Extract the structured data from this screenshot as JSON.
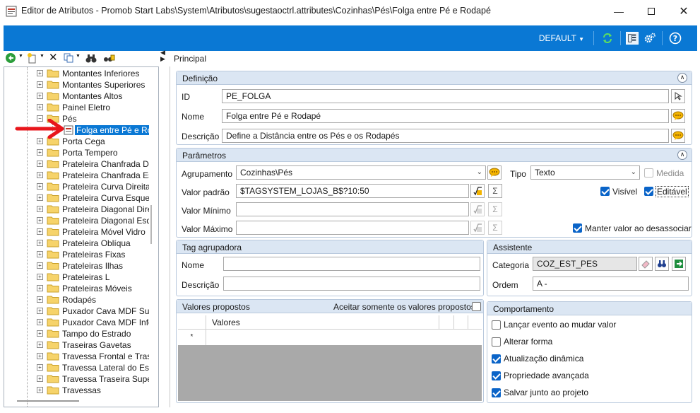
{
  "window": {
    "title": "Editor de Atributos - Promob Start Labs\\System\\Atributos\\sugestaoctrl.attributes\\Cozinhas\\Pés\\Folga entre Pé e Rodapé"
  },
  "toolbar": {
    "profile_label": "DEFAULT"
  },
  "tree": {
    "items": [
      {
        "label": "Montantes Inferiores"
      },
      {
        "label": "Montantes Superiores"
      },
      {
        "label": "Montantes Altos"
      },
      {
        "label": "Painel Eletro"
      },
      {
        "label": "Pés"
      },
      {
        "label": "Folga entre Pé e Rodapé",
        "selected": true
      },
      {
        "label": "Porta Cega"
      },
      {
        "label": "Porta Tempero"
      },
      {
        "label": "Prateleira Chanfrada Direita"
      },
      {
        "label": "Prateleira Chanfrada Esquerda"
      },
      {
        "label": "Prateleira Curva Direita"
      },
      {
        "label": "Prateleira Curva Esquerda"
      },
      {
        "label": "Prateleira Diagonal Direita"
      },
      {
        "label": "Prateleira Diagonal Esquerda"
      },
      {
        "label": "Prateleira Móvel Vidro"
      },
      {
        "label": "Prateleira Oblíqua"
      },
      {
        "label": "Prateleiras Fixas"
      },
      {
        "label": "Prateleiras Ilhas"
      },
      {
        "label": "Prateleiras L"
      },
      {
        "label": "Prateleiras Móveis"
      },
      {
        "label": "Rodapés"
      },
      {
        "label": "Puxador Cava MDF Superior"
      },
      {
        "label": "Puxador Cava MDF Inferior"
      },
      {
        "label": "Tampo do Estrado"
      },
      {
        "label": "Traseiras Gavetas"
      },
      {
        "label": "Travessa Frontal e Traseira"
      },
      {
        "label": "Travessa Lateral do Estrado"
      },
      {
        "label": "Travessa Traseira Superior"
      },
      {
        "label": "Travessas"
      }
    ]
  },
  "tabs": {
    "principal": "Principal"
  },
  "definicao": {
    "title": "Definição",
    "id_label": "ID",
    "id_value": "PE_FOLGA",
    "nome_label": "Nome",
    "nome_value": "Folga entre Pé e Rodapé",
    "descricao_label": "Descrição",
    "descricao_value": "Define a Distância entre os Pés e os Rodapés"
  },
  "parametros": {
    "title": "Parâmetros",
    "agrupamento_label": "Agrupamento",
    "agrupamento_value": "Cozinhas\\Pés",
    "tipo_label": "Tipo",
    "tipo_value": "Texto",
    "medida_label": "Medida",
    "valor_padrao_label": "Valor padrão",
    "valor_padrao_value": "$TAGSYSTEM_LOJAS_B$?10:50",
    "valor_minimo_label": "Valor Mínimo",
    "valor_minimo_value": "",
    "valor_maximo_label": "Valor Máximo",
    "valor_maximo_value": "",
    "visivel_label": "Visível",
    "editavel_label": "Editável",
    "manter_label": "Manter valor ao desassociar"
  },
  "tag": {
    "title": "Tag agrupadora",
    "nome_label": "Nome",
    "descricao_label": "Descrição"
  },
  "assistente": {
    "title": "Assistente",
    "categoria_label": "Categoria",
    "categoria_value": "COZ_EST_PES",
    "ordem_label": "Ordem",
    "ordem_value": "A -"
  },
  "valores": {
    "title": "Valores propostos",
    "aceitar_label": "Aceitar somente os valores propostos",
    "col_valores": "Valores",
    "new_row_marker": "*"
  },
  "comportamento": {
    "title": "Comportamento",
    "lancar_label": "Lançar evento ao mudar valor",
    "alterar_label": "Alterar forma",
    "atualizacao_label": "Atualização dinâmica",
    "propriedade_label": "Propriedade avançada",
    "salvar_label": "Salvar junto ao projeto"
  }
}
